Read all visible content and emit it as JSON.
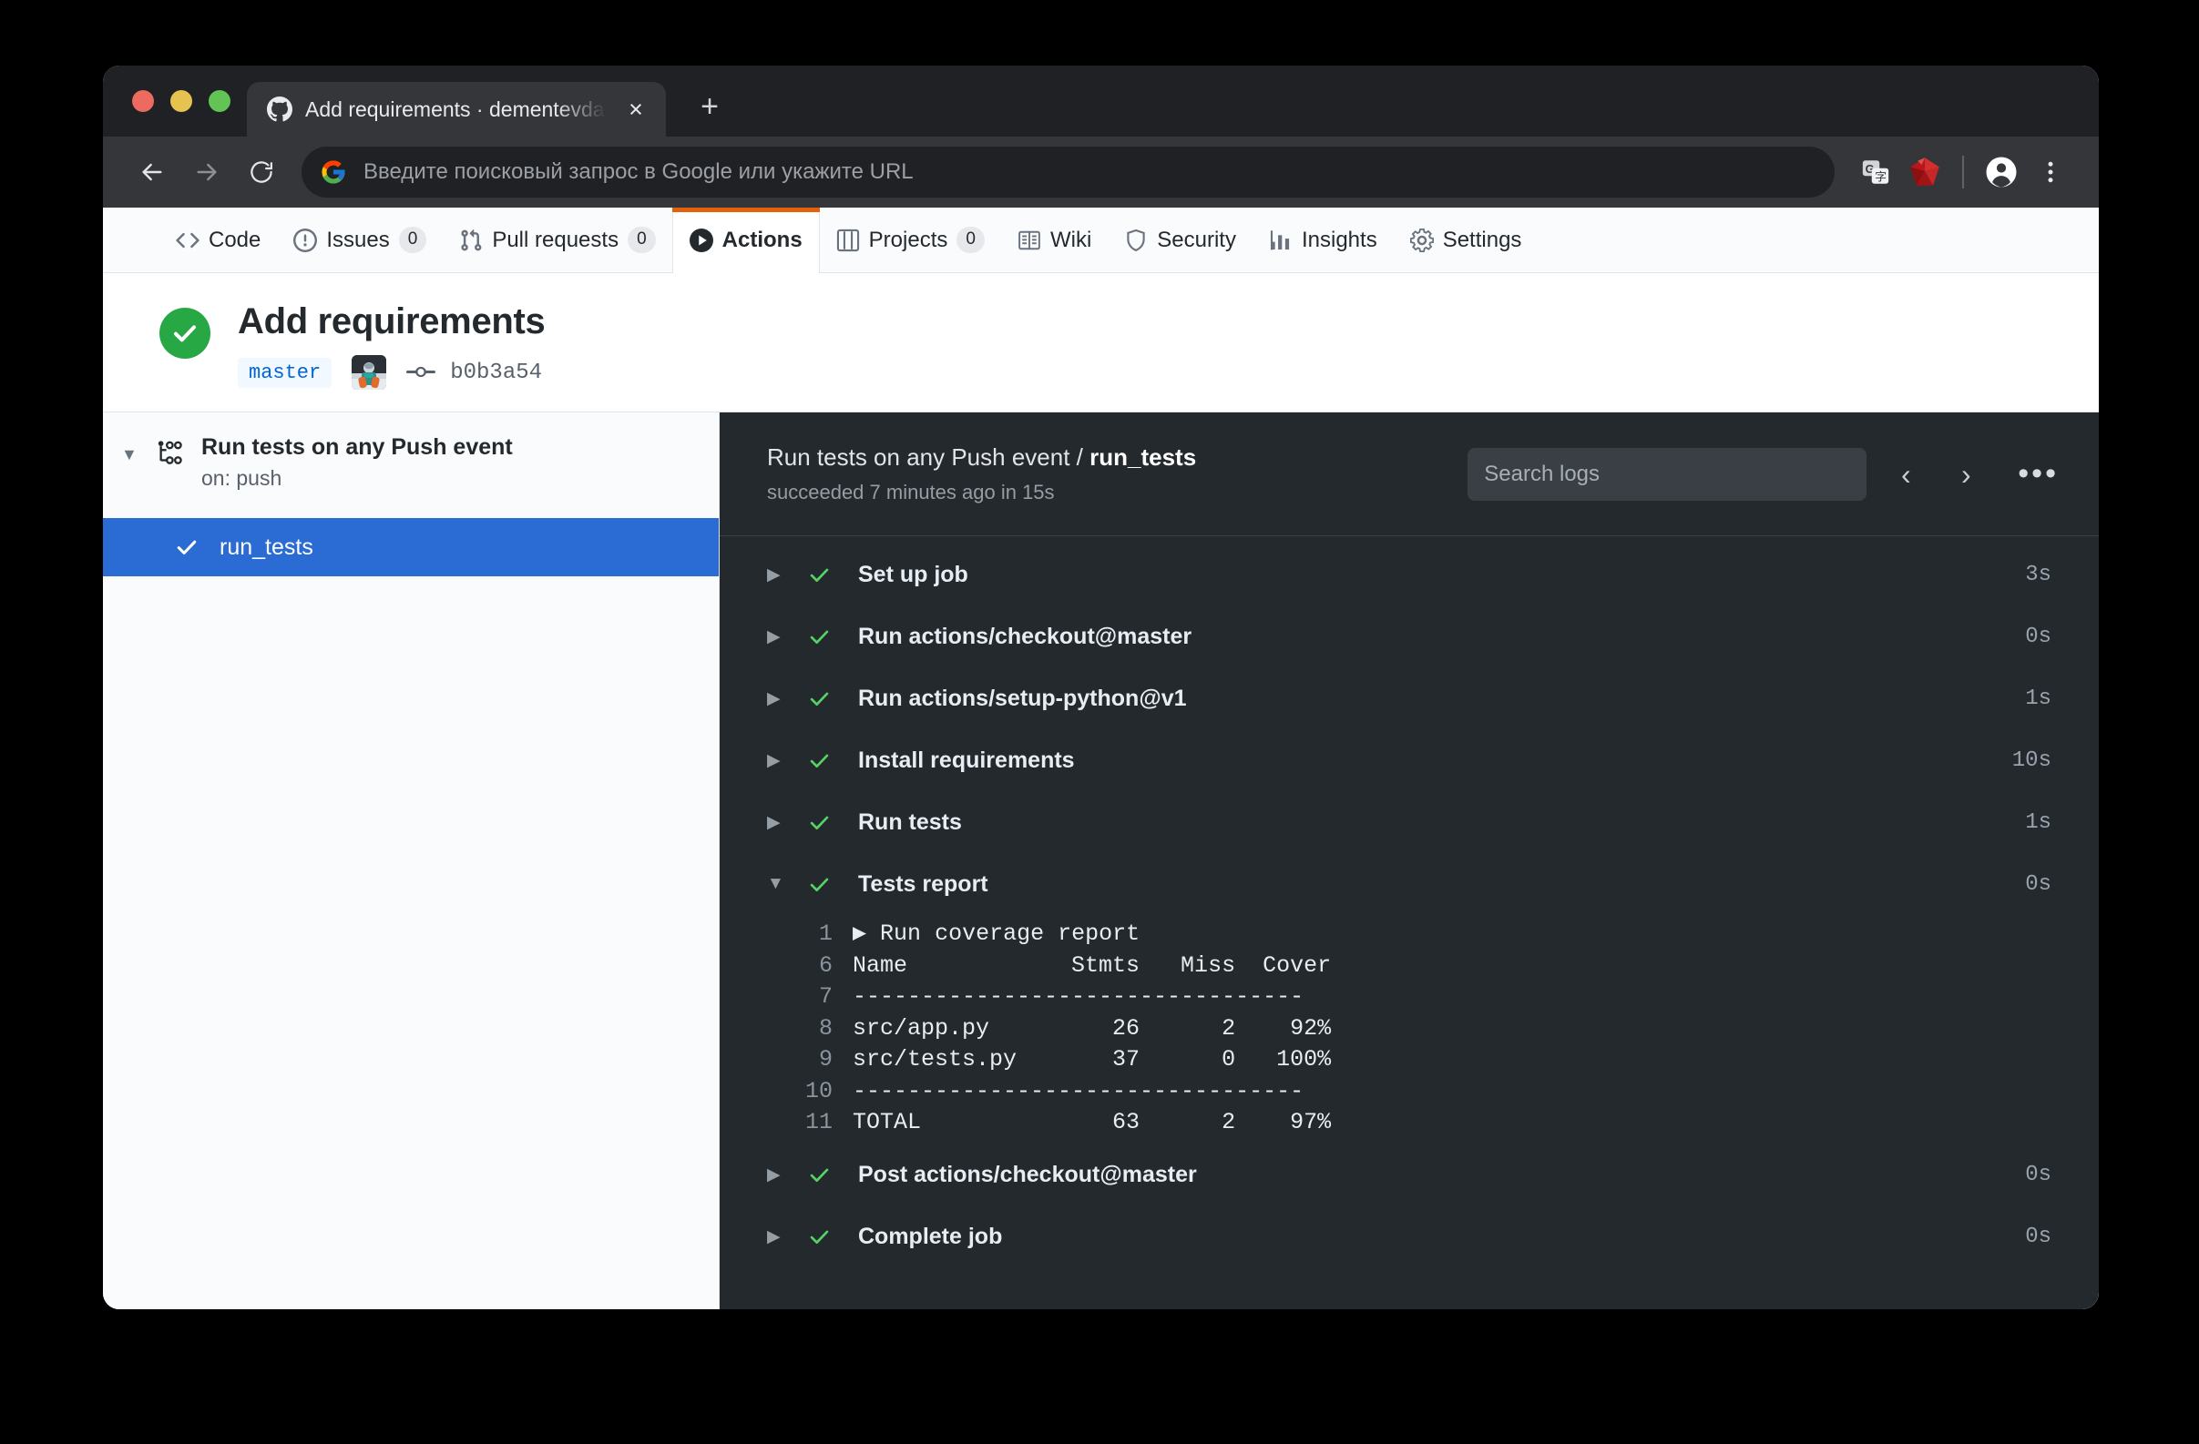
{
  "browser": {
    "tab": {
      "title": "Add requirements · dementevda/",
      "favicon": "github-icon",
      "close": "×"
    },
    "new_tab_label": "+",
    "omnibox": {
      "placeholder": "Введите поисковый запрос в Google или укажите URL",
      "value": "",
      "leading_icon": "google-icon"
    },
    "toolbar_icons": [
      "back-icon",
      "forward-icon",
      "reload-icon",
      "translate-icon",
      "ruby-extension-icon",
      "profile-icon",
      "chrome-menu-icon"
    ]
  },
  "repo_nav": {
    "tabs": [
      {
        "label": "Code",
        "icon": "code-icon",
        "count": null,
        "selected": false
      },
      {
        "label": "Issues",
        "icon": "issue-opened-icon",
        "count": "0",
        "selected": false
      },
      {
        "label": "Pull requests",
        "icon": "git-pull-request-icon",
        "count": "0",
        "selected": false
      },
      {
        "label": "Actions",
        "icon": "play-icon",
        "count": null,
        "selected": true
      },
      {
        "label": "Projects",
        "icon": "project-icon",
        "count": "0",
        "selected": false
      },
      {
        "label": "Wiki",
        "icon": "book-icon",
        "count": null,
        "selected": false
      },
      {
        "label": "Security",
        "icon": "shield-icon",
        "count": null,
        "selected": false
      },
      {
        "label": "Insights",
        "icon": "graph-icon",
        "count": null,
        "selected": false
      },
      {
        "label": "Settings",
        "icon": "gear-icon",
        "count": null,
        "selected": false
      }
    ],
    "accent_color": "#e36209"
  },
  "run_header": {
    "status": "success",
    "status_icon": "check-icon",
    "status_color": "#28a745",
    "title": "Add requirements",
    "branch": "master",
    "avatar": "user-avatar",
    "commit_icon": "git-commit-icon",
    "commit_sha": "b0b3a54"
  },
  "sidebar": {
    "workflow": {
      "caret": "▼",
      "icon": "workflow-icon",
      "name": "Run tests on any Push event",
      "trigger": "on: push"
    },
    "jobs": [
      {
        "name": "run_tests",
        "status_icon": "check-icon",
        "selected": true,
        "highlight_color": "#2b6cd4"
      }
    ]
  },
  "log": {
    "breadcrumb_prefix": "Run tests on any Push event / ",
    "breadcrumb_job": "run_tests",
    "subtitle": "succeeded 7 minutes ago in 15s",
    "search_placeholder": "Search logs",
    "search_value": "",
    "prev_label": "‹",
    "next_label": "›",
    "more_label": "•••",
    "steps": [
      {
        "label": "Set up job",
        "duration": "3s",
        "expanded": false,
        "status": "success"
      },
      {
        "label": "Run actions/checkout@master",
        "duration": "0s",
        "expanded": false,
        "status": "success"
      },
      {
        "label": "Run actions/setup-python@v1",
        "duration": "1s",
        "expanded": false,
        "status": "success"
      },
      {
        "label": "Install requirements",
        "duration": "10s",
        "expanded": false,
        "status": "success"
      },
      {
        "label": "Run tests",
        "duration": "1s",
        "expanded": false,
        "status": "success"
      },
      {
        "label": "Tests report",
        "duration": "0s",
        "expanded": true,
        "status": "success"
      },
      {
        "label": "Post actions/checkout@master",
        "duration": "0s",
        "expanded": false,
        "status": "success"
      },
      {
        "label": "Complete job",
        "duration": "0s",
        "expanded": false,
        "status": "success"
      }
    ],
    "output_lines": [
      {
        "no": "1",
        "text": "▶ Run coverage report"
      },
      {
        "no": "6",
        "text": "Name            Stmts   Miss  Cover"
      },
      {
        "no": "7",
        "text": "---------------------------------"
      },
      {
        "no": "8",
        "text": "src/app.py         26      2    92%"
      },
      {
        "no": "9",
        "text": "src/tests.py       37      0   100%"
      },
      {
        "no": "10",
        "text": "---------------------------------"
      },
      {
        "no": "11",
        "text": "TOTAL              63      2    97%"
      }
    ],
    "coverage_table": {
      "columns": [
        "Name",
        "Stmts",
        "Miss",
        "Cover"
      ],
      "rows": [
        [
          "src/app.py",
          "26",
          "2",
          "92%"
        ],
        [
          "src/tests.py",
          "37",
          "0",
          "100%"
        ],
        [
          "TOTAL",
          "63",
          "2",
          "97%"
        ]
      ]
    }
  }
}
